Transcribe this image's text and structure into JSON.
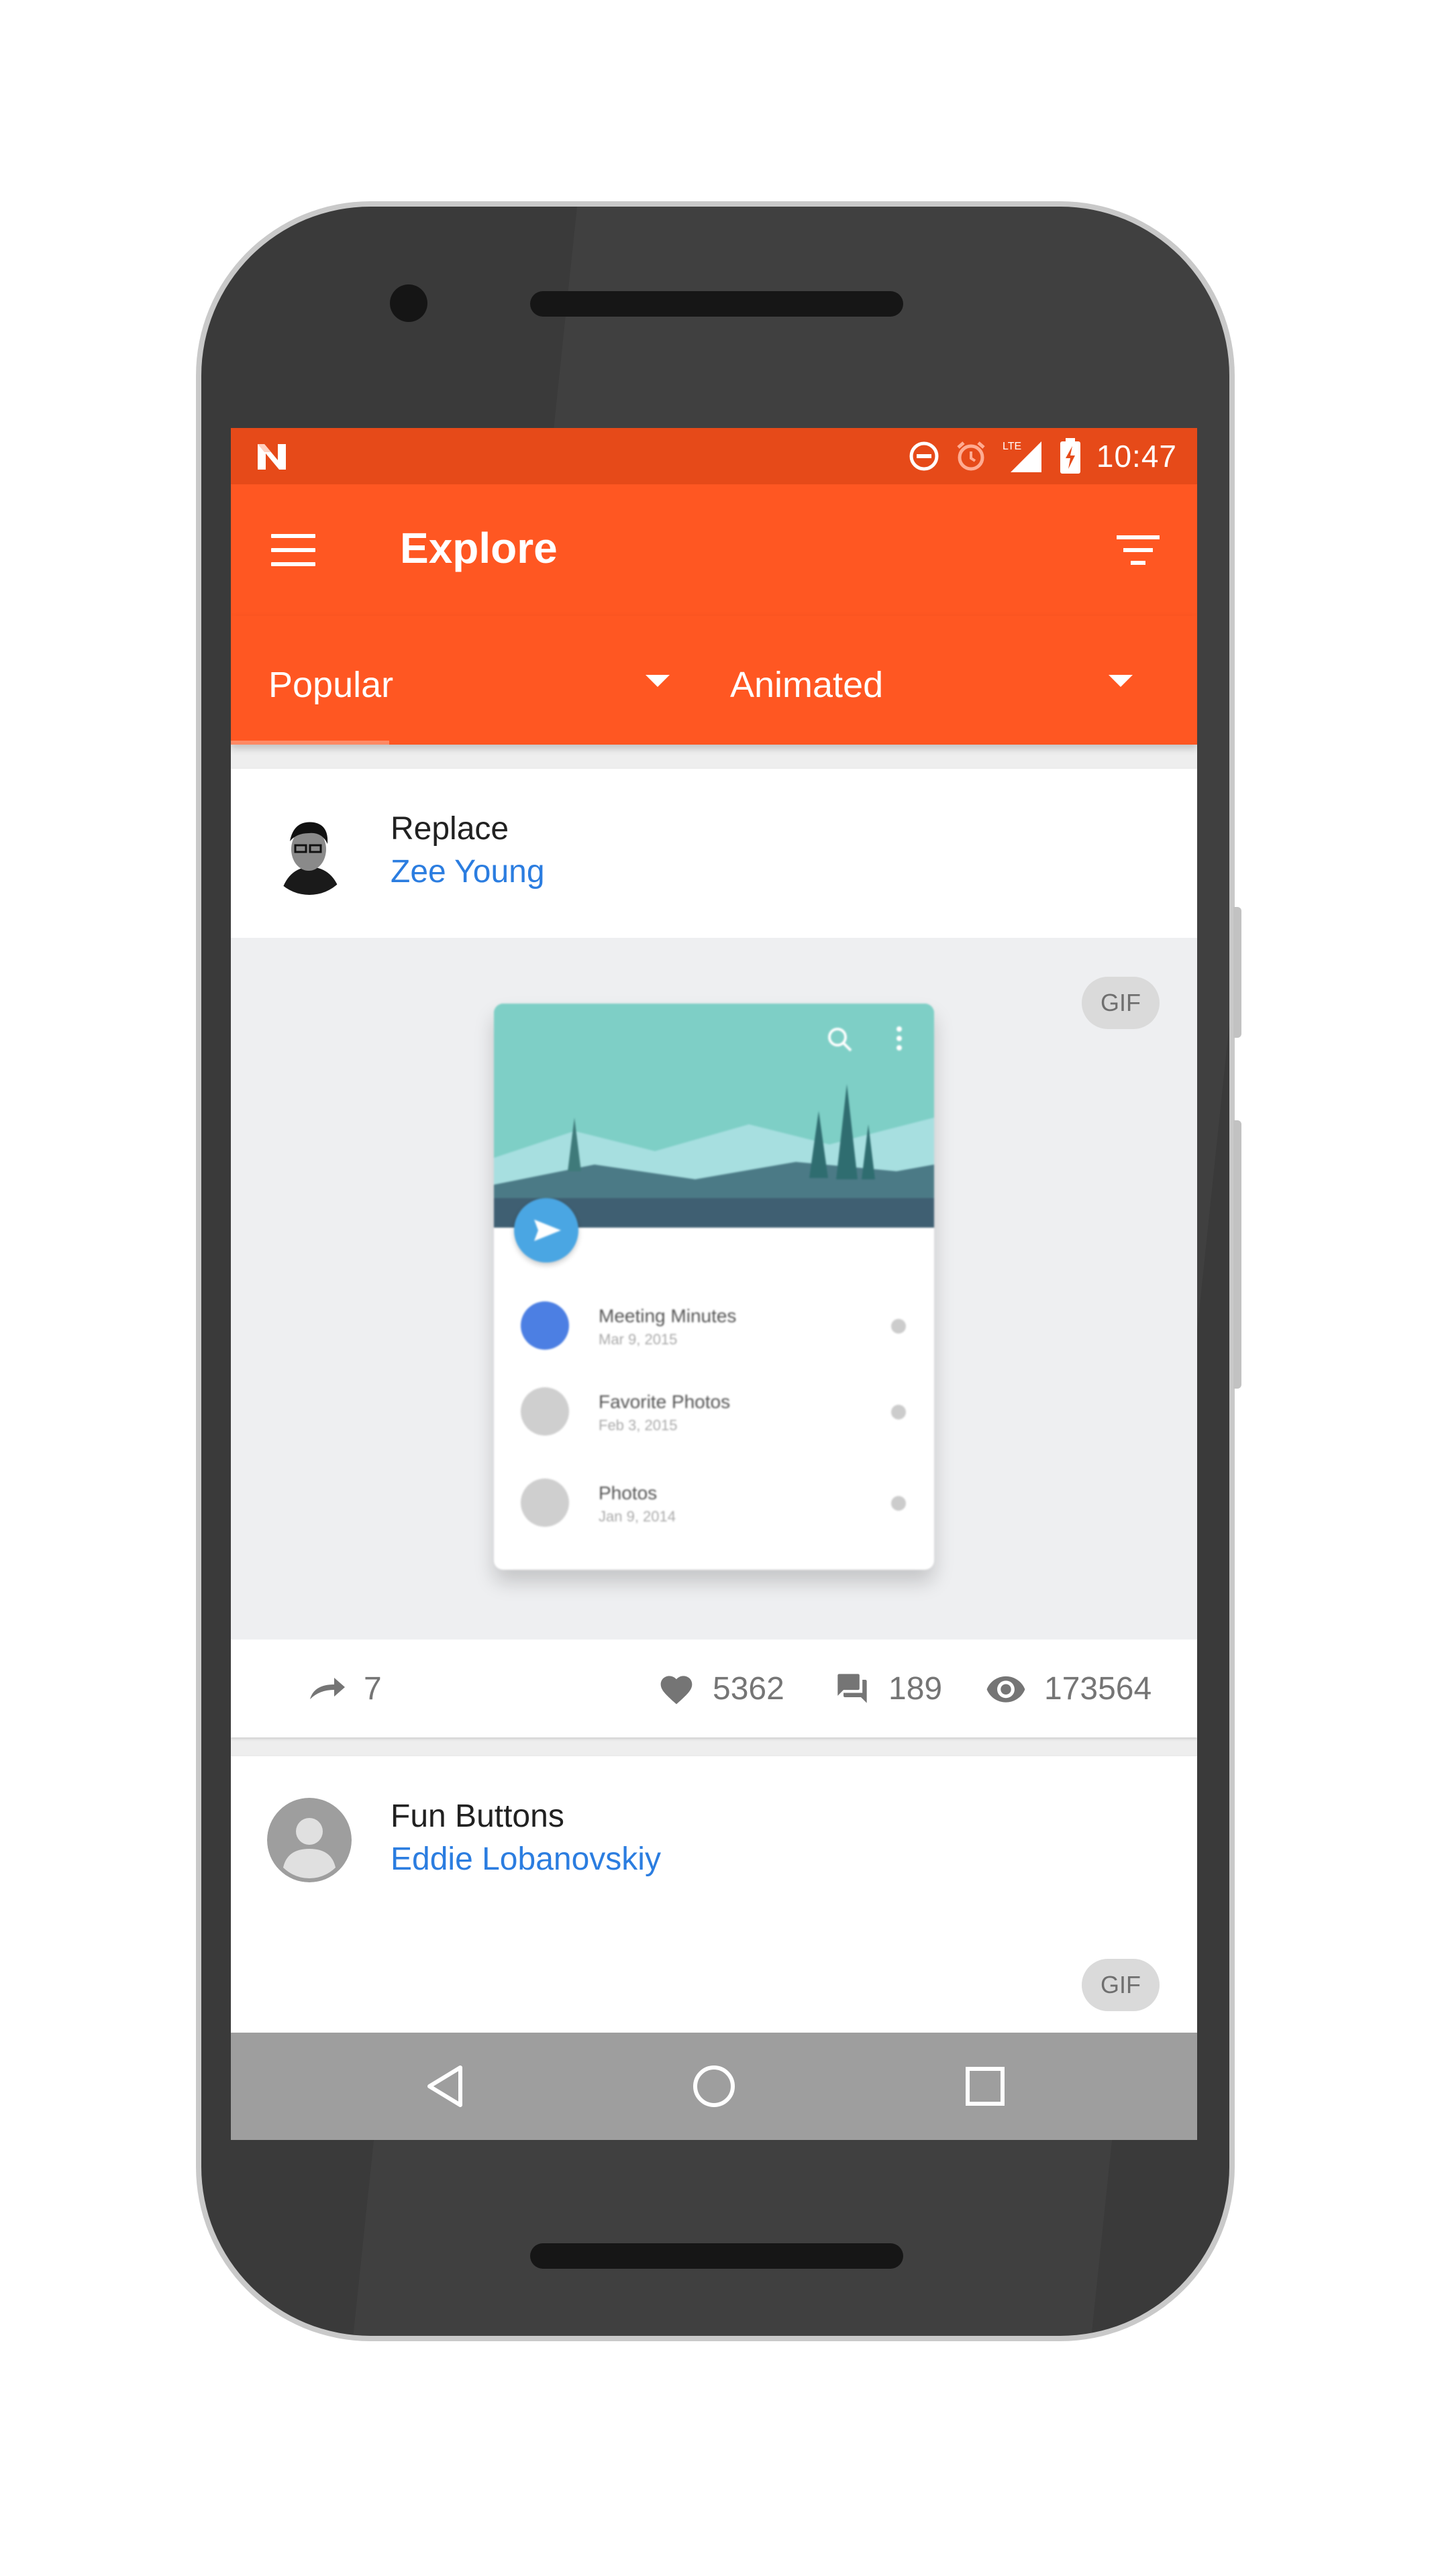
{
  "status_bar": {
    "time": "10:47",
    "network_label": "LTE",
    "icons": [
      "n-notification-icon",
      "do-not-disturb-icon",
      "alarm-icon",
      "signal-icon",
      "battery-charging-icon"
    ]
  },
  "app_bar": {
    "title": "Explore",
    "menu_icon": "hamburger-menu-icon",
    "filter_icon": "filter-list-icon"
  },
  "tabs": [
    {
      "label": "Popular",
      "selected": true
    },
    {
      "label": "Animated",
      "selected": false
    }
  ],
  "shots": [
    {
      "title": "Replace",
      "author": "Zee Young",
      "badge": "GIF",
      "preview": {
        "items": [
          {
            "name": "Meeting Minutes",
            "date": "Mar 9, 2015"
          },
          {
            "name": "Favorite Photos",
            "date": "Feb 3, 2015"
          },
          {
            "name": "Photos",
            "date": "Jan 9, 2014"
          }
        ]
      },
      "stats": {
        "rebounds": "7",
        "likes": "5362",
        "comments": "189",
        "views": "173564"
      }
    },
    {
      "title": "Fun Buttons",
      "author": "Eddie Lobanovskiy",
      "badge": "GIF"
    }
  ],
  "nav_bar": {
    "buttons": [
      "back-icon",
      "home-icon",
      "recents-icon"
    ]
  },
  "colors": {
    "status_bar": "#e64a19",
    "app_bar": "#ff5722",
    "link": "#2b7de0",
    "nav_bar": "#9e9e9e"
  }
}
